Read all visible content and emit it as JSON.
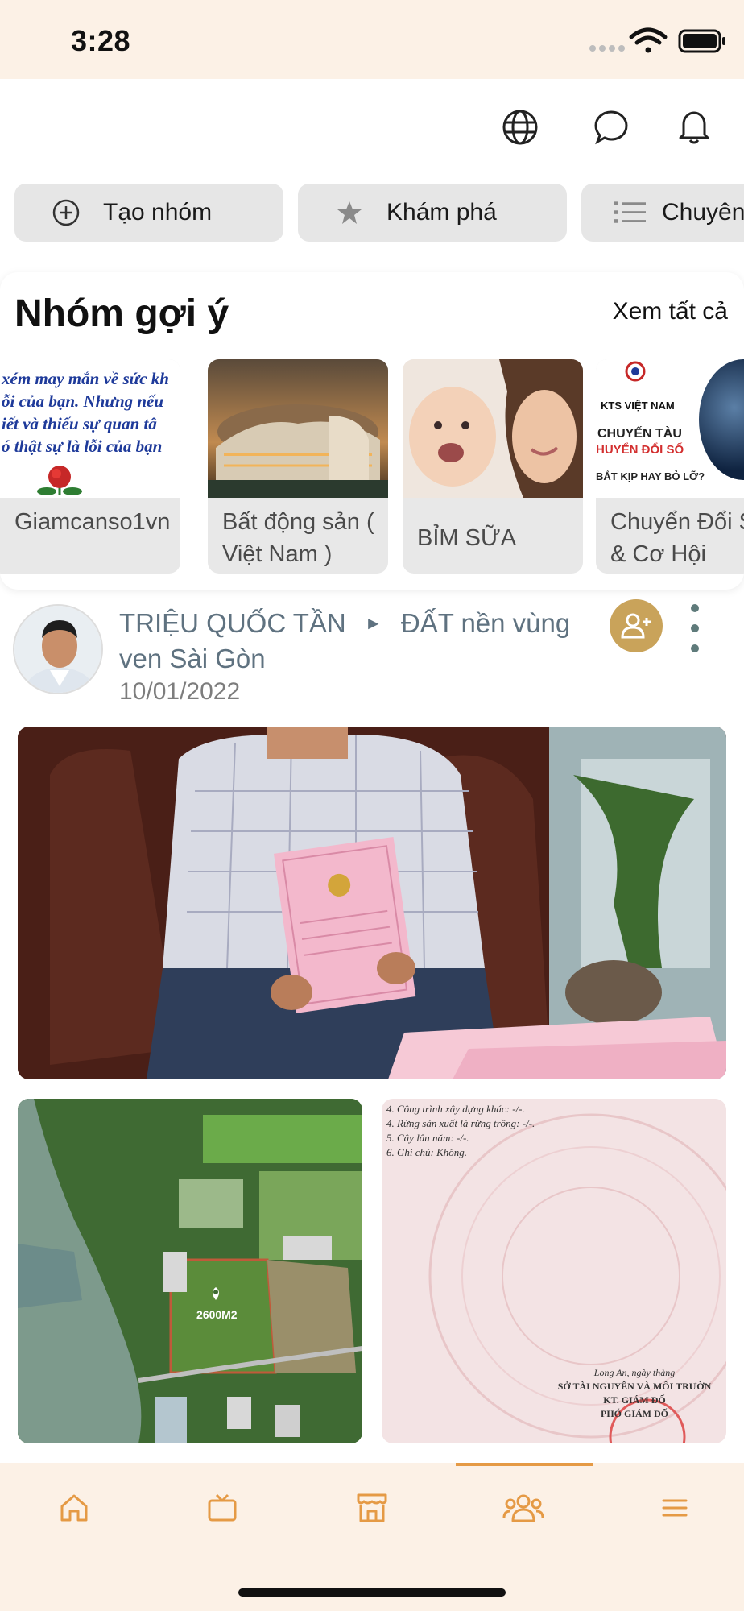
{
  "status_bar": {
    "time": "3:28"
  },
  "top_bar": {
    "icons": [
      "globe-icon",
      "chat-icon",
      "bell-icon"
    ]
  },
  "chips": [
    {
      "label": "Tạo nhóm",
      "icon": "plus-circle-icon"
    },
    {
      "label": "Khám phá",
      "icon": "star-icon"
    },
    {
      "label": "Chuyên",
      "icon": "list-icon"
    }
  ],
  "suggested_groups": {
    "title": "Nhóm gợi ý",
    "see_all": "Xem tất cả",
    "items": [
      {
        "name": "Giamcanso1vn",
        "thumb_lines": [
          "xém may mắn về sức kh",
          "ỗi của bạn. Nhưng nếu",
          "iết và thiếu sự quan tâ",
          "ó thật sự là lỗi của bạn"
        ]
      },
      {
        "name": "Bất động sản ( Việt Nam )"
      },
      {
        "name": "BỈM SỮA"
      },
      {
        "name": "Chuyển Đổi Số & Cơ Hội",
        "thumb_lines": [
          "KTS VIỆT NAM",
          "CHUYẾN TÀU",
          "HUYỂN ĐỔI SỐ",
          "BẮT KỊP HAY BỎ LỠ?"
        ]
      }
    ]
  },
  "post": {
    "author": "TRIỆU QUỐC TẦN",
    "separator": "►",
    "group": "ĐẤT nền vùng ven Sài Gòn",
    "date": "10/01/2022",
    "map_label": "2600M2",
    "doc_lines": [
      "4. Công trình xây dựng khác: -/-.",
      "4. Rừng sản xuất là rừng trồng: -/-.",
      "5. Cây lâu năm: -/-.",
      "6. Ghi chú: Không.",
      "Long An, ngày  thàng",
      "SỞ TÀI NGUYÊN VÀ MÔI TRƯỜN",
      "KT. GIÁM ĐỐ",
      "PHÓ GIÁM ĐỐ"
    ]
  },
  "bottom_nav": {
    "items": [
      "home-icon",
      "tv-icon",
      "store-icon",
      "groups-icon",
      "menu-icon"
    ],
    "active_index": 3,
    "accent": "#e59a45"
  },
  "colors": {
    "cream": "#fcf1e6",
    "chip_bg": "#e6e6e6",
    "follow": "#c9a35a",
    "meta": "#5f7280"
  }
}
